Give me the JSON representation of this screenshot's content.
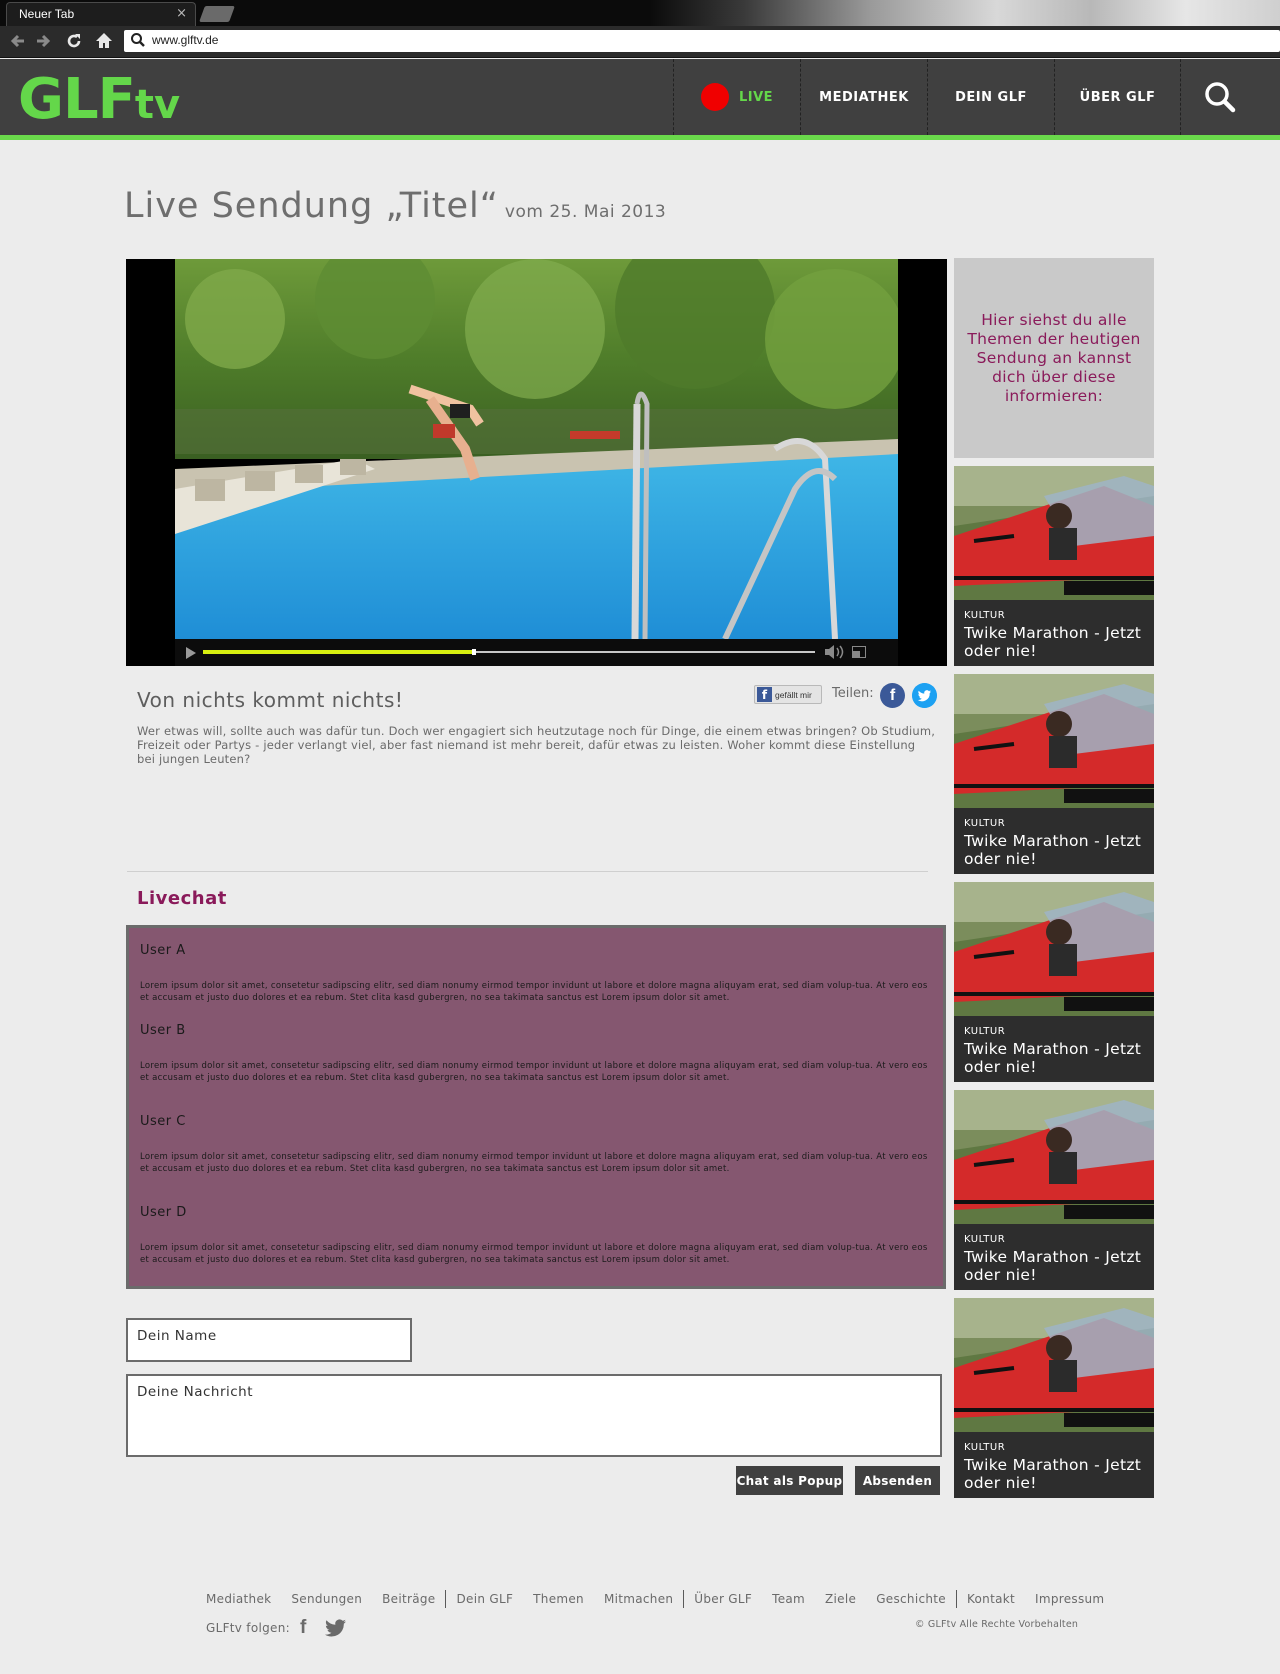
{
  "browser": {
    "tab_title": "Neuer Tab",
    "tab_close": "×",
    "url": "www.glftv.de",
    "icons": [
      "back-icon",
      "forward-icon",
      "reload-icon",
      "home-icon",
      "search-icon"
    ]
  },
  "header": {
    "logo_main": "GLF",
    "logo_sub": "tv",
    "nav": [
      "LIVE",
      "MEDIATHEK",
      "DEIN GLF",
      "ÜBER GLF"
    ],
    "colors": {
      "accent": "#64d74a",
      "live_dot": "#f00000",
      "bar": "#404040"
    }
  },
  "page": {
    "title": "Live Sendung „Titel“",
    "date": "vom 25. Mai 2013"
  },
  "video": {
    "progress": 0.44,
    "colors": {
      "progress": "#d7ef10"
    }
  },
  "sidebar": {
    "intro": "Hier siehst du alle Themen der heutigen Sendung an kannst dich über diese informieren:",
    "cards": [
      {
        "category": "KULTUR",
        "title": "Twike Marathon - Jetzt oder nie!"
      },
      {
        "category": "KULTUR",
        "title": "Twike Marathon - Jetzt oder nie!"
      },
      {
        "category": "KULTUR",
        "title": "Twike Marathon - Jetzt oder nie!"
      },
      {
        "category": "KULTUR",
        "title": "Twike Marathon - Jetzt oder nie!"
      },
      {
        "category": "KULTUR",
        "title": "Twike Marathon - Jetzt oder nie!"
      }
    ]
  },
  "description": {
    "title": "Von nichts kommt nichts!",
    "like_label": "gefällt mir",
    "share_label": "Teilen:",
    "text": "Wer etwas will, sollte auch was dafür tun. Doch wer engagiert sich heutzutage noch für Dinge, die einem etwas bringen? Ob Studium, Freizeit oder Partys - jeder verlangt viel, aber fast niemand ist mehr bereit, dafür etwas zu leisten. Woher kommt diese Einstellung bei jungen Leuten?"
  },
  "chat": {
    "title": "Livechat",
    "messages": [
      {
        "user": "User A",
        "text": "Lorem ipsum dolor sit amet, consetetur sadipscing elitr, sed diam nonumy eirmod tempor invidunt ut labore et dolore magna aliquyam erat, sed diam volup-tua. At vero eos et accusam et justo duo dolores et ea rebum. Stet clita kasd gubergren, no sea takimata sanctus est Lorem ipsum dolor sit amet."
      },
      {
        "user": "User B",
        "text": "Lorem ipsum dolor sit amet, consetetur sadipscing elitr, sed diam nonumy eirmod tempor invidunt ut labore et dolore magna aliquyam erat, sed diam volup-tua. At vero eos et accusam et justo duo dolores et ea rebum. Stet clita kasd gubergren, no sea takimata sanctus est Lorem ipsum dolor sit amet."
      },
      {
        "user": "User C",
        "text": "Lorem ipsum dolor sit amet, consetetur sadipscing elitr, sed diam nonumy eirmod tempor invidunt ut labore et dolore magna aliquyam erat, sed diam volup-tua. At vero eos et accusam et justo duo dolores et ea rebum. Stet clita kasd gubergren, no sea takimata sanctus est Lorem ipsum dolor sit amet."
      },
      {
        "user": "User D",
        "text": "Lorem ipsum dolor sit amet, consetetur sadipscing elitr, sed diam nonumy eirmod tempor invidunt ut labore et dolore magna aliquyam erat, sed diam volup-tua. At vero eos et accusam et justo duo dolores et ea rebum. Stet clita kasd gubergren, no sea takimata sanctus est Lorem ipsum dolor sit amet."
      }
    ],
    "colors": {
      "box": "#855770",
      "title": "#8a1a5a"
    },
    "name_placeholder": "Dein Name",
    "message_placeholder": "Deine Nachricht",
    "popup_button": "Chat als Popup",
    "send_button": "Absenden"
  },
  "footer": {
    "links": [
      "Mediathek",
      "Sendungen",
      "Beiträge",
      "Dein GLF",
      "Themen",
      "Mitmachen",
      "Über GLF",
      "Team",
      "Ziele",
      "Geschichte",
      "Kontakt",
      "Impressum"
    ],
    "follow_label": "GLFtv folgen:",
    "copyright": "© GLFtv Alle Rechte Vorbehalten"
  }
}
